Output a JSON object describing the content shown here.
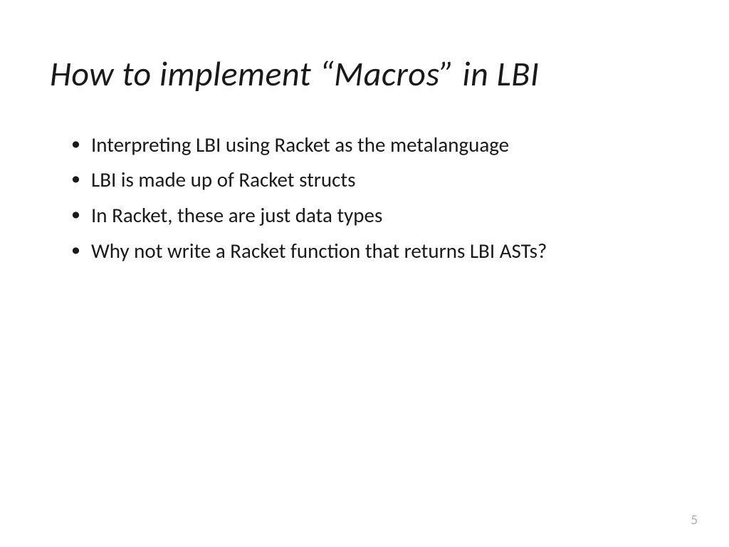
{
  "slide": {
    "title": "How to implement “Macros” in LBI",
    "bullets": [
      "Interpreting LBI using Racket as the metalanguage",
      "LBI is made up of Racket structs",
      "In Racket, these are just data types",
      "Why not write a Racket function that returns LBI ASTs?"
    ],
    "page_number": "5"
  }
}
